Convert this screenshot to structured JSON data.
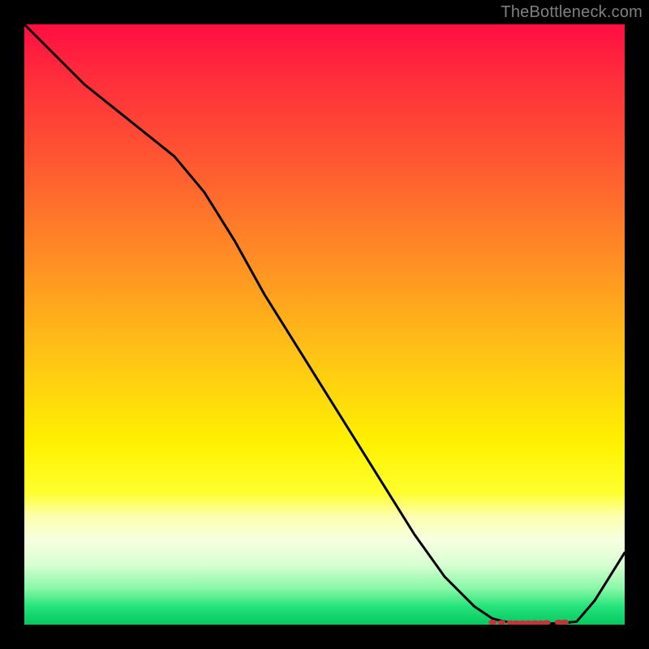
{
  "watermark": "TheBottleneck.com",
  "chart_data": {
    "type": "line",
    "title": "",
    "xlabel": "",
    "ylabel": "",
    "xlim": [
      0,
      100
    ],
    "ylim": [
      0,
      100
    ],
    "grid": false,
    "legend": false,
    "series": [
      {
        "name": "curve",
        "x": [
          0,
          5,
          10,
          15,
          20,
          25,
          30,
          35,
          40,
          45,
          50,
          55,
          60,
          65,
          70,
          75,
          78,
          80,
          82,
          84,
          86,
          88,
          90,
          92,
          95,
          100
        ],
        "y": [
          100,
          95,
          90,
          86,
          82,
          78,
          72,
          64,
          55,
          47,
          39,
          31,
          23,
          15,
          8,
          3,
          1,
          0.5,
          0.3,
          0.2,
          0.2,
          0.2,
          0.3,
          0.5,
          4,
          12
        ]
      }
    ],
    "markers": {
      "name": "floor-dots",
      "x": [
        78,
        79.5,
        81,
        82,
        83,
        84,
        85,
        86,
        87,
        89,
        90
      ],
      "y": [
        0.4,
        0.35,
        0.3,
        0.3,
        0.3,
        0.3,
        0.3,
        0.3,
        0.35,
        0.4,
        0.4
      ]
    }
  },
  "colors": {
    "background": "#000000",
    "watermark": "#808080",
    "line": "#000000",
    "marker": "#c8323a"
  }
}
